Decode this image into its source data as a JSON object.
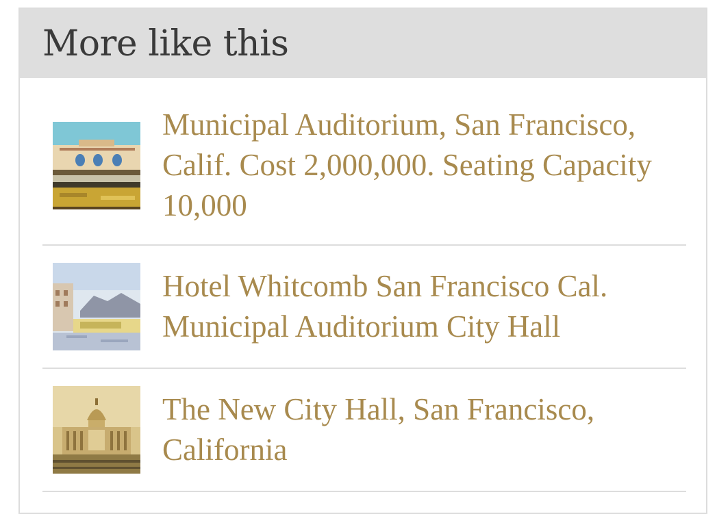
{
  "panel": {
    "title": "More like this"
  },
  "items": [
    {
      "title": "Municipal Auditorium, San Francisco, Calif. Cost 2,000,000. Seating Capacity 10,000",
      "thumbnail": "auditorium-postcard-thumbnail"
    },
    {
      "title": "Hotel Whitcomb San Francisco Cal. Municipal Auditorium City Hall",
      "thumbnail": "hotel-whitcomb-postcard-thumbnail"
    },
    {
      "title": "The New City Hall, San Francisco, California",
      "thumbnail": "city-hall-postcard-thumbnail"
    }
  ],
  "colors": {
    "header_bg": "#dedede",
    "title_text": "#3a3a3a",
    "link": "#a88a4e",
    "divider": "#dddddd"
  }
}
